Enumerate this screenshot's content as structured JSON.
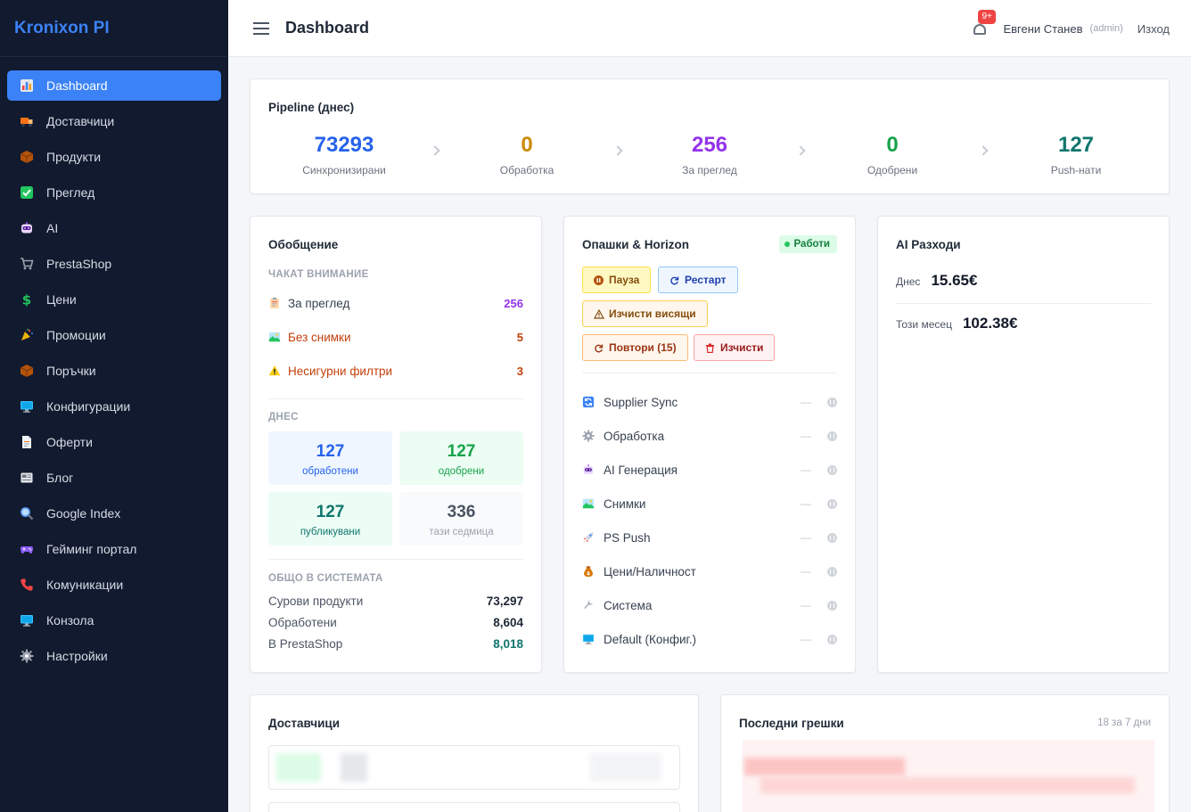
{
  "app": {
    "brand": "Kronixon PI",
    "page_title": "Dashboard"
  },
  "sidebar": {
    "items": [
      {
        "label": "Dashboard",
        "icon": "bar-chart-icon",
        "color": "#f59e0b",
        "active": true
      },
      {
        "label": "Доставчици",
        "icon": "truck-icon",
        "color": "#f97316"
      },
      {
        "label": "Продукти",
        "icon": "package-icon",
        "color": "#b45309"
      },
      {
        "label": "Преглед",
        "icon": "check-box-icon",
        "color": "#22c55e"
      },
      {
        "label": "AI",
        "icon": "robot-icon",
        "color": "#a855f7"
      },
      {
        "label": "PrestaShop",
        "icon": "cart-icon",
        "color": "#9ca3af"
      },
      {
        "label": "Цени",
        "icon": "dollar-icon",
        "color": "#22c55e"
      },
      {
        "label": "Промоции",
        "icon": "party-popper-icon",
        "color": "#eab308"
      },
      {
        "label": "Поръчки",
        "icon": "package-icon",
        "color": "#b45309"
      },
      {
        "label": "Конфигурации",
        "icon": "monitor-icon",
        "color": "#38bdf8"
      },
      {
        "label": "Оферти",
        "icon": "document-icon",
        "color": "#f1f5f9"
      },
      {
        "label": "Блог",
        "icon": "newspaper-icon",
        "color": "#e5e7eb"
      },
      {
        "label": "Google Index",
        "icon": "magnifier-icon",
        "color": "#60a5fa"
      },
      {
        "label": "Гейминг портал",
        "icon": "gamepad-icon",
        "color": "#8b5cf6"
      },
      {
        "label": "Комуникации",
        "icon": "phone-icon",
        "color": "#ef4444"
      },
      {
        "label": "Конзола",
        "icon": "monitor-icon",
        "color": "#38bdf8"
      },
      {
        "label": "Настройки",
        "icon": "gear-icon",
        "color": "#9ca3af"
      }
    ]
  },
  "topbar": {
    "notification_badge": "9+",
    "user_name": "Евгени Станев",
    "user_role": "(admin)",
    "logout": "Изход"
  },
  "pipeline": {
    "title": "Pipeline (днес)",
    "stages": [
      {
        "value": "73293",
        "label": "Синхронизирани",
        "color": "#2563eb"
      },
      {
        "value": "0",
        "label": "Обработка",
        "color": "#ca8a04"
      },
      {
        "value": "256",
        "label": "За преглед",
        "color": "#9333ea"
      },
      {
        "value": "0",
        "label": "Одобрени",
        "color": "#16a34a"
      },
      {
        "value": "127",
        "label": "Push-нати",
        "color": "#0f766e"
      }
    ]
  },
  "summary": {
    "title": "Обобщение",
    "attention_label": "ЧАКАТ ВНИМАНИЕ",
    "attention": [
      {
        "text": "За преглед",
        "count": "256",
        "icon": "clipboard-icon",
        "text_color": "#374151",
        "count_color": "#9333ea"
      },
      {
        "text": "Без снимки",
        "count": "5",
        "icon": "picture-icon",
        "text_color": "#c2410c",
        "count_color": "#c2410c"
      },
      {
        "text": "Несигурни филтри",
        "count": "3",
        "icon": "warning-icon",
        "text_color": "#c2410c",
        "count_color": "#c2410c"
      }
    ],
    "today_label": "ДНЕС",
    "tiles": [
      {
        "value": "127",
        "label": "обработени",
        "bg": "#eff6ff",
        "color": "#2563eb"
      },
      {
        "value": "127",
        "label": "одобрени",
        "bg": "#ecfdf3",
        "color": "#16a34a"
      },
      {
        "value": "127",
        "label": "публикувани",
        "bg": "#ecfdf5",
        "color": "#0f766e"
      },
      {
        "value": "336",
        "label": "тази седмица",
        "bg": "#f8fafc",
        "color": "#4b5563"
      }
    ],
    "totals_label": "ОБЩО В СИСТЕМАТА",
    "totals": [
      {
        "label": "Сурови продукти",
        "value": "73,297",
        "color": "#1f2937"
      },
      {
        "label": "Обработени",
        "value": "8,604",
        "color": "#1f2937"
      },
      {
        "label": "В PrestaShop",
        "value": "8,018",
        "color": "#0f766e"
      }
    ]
  },
  "queues": {
    "title": "Опашки & Horizon",
    "status": "Работи",
    "buttons": {
      "pause": "Пауза",
      "restart": "Рестарт",
      "clear_stuck": "Изчисти висящи",
      "retry": "Повтори (15)",
      "clear": "Изчисти"
    },
    "rows": [
      {
        "label": "Supplier Sync",
        "icon": "sync-icon",
        "color": "#3b82f6",
        "state": "—"
      },
      {
        "label": "Обработка",
        "icon": "gear-icon",
        "color": "#9ca3af",
        "state": "—"
      },
      {
        "label": "AI Генерация",
        "icon": "robot-icon",
        "color": "#a855f7",
        "state": "—"
      },
      {
        "label": "Снимки",
        "icon": "picture-icon",
        "color": "#16a34a",
        "state": "—"
      },
      {
        "label": "PS Push",
        "icon": "rocket-icon",
        "color": "#ef4444",
        "state": "—"
      },
      {
        "label": "Цени/Наличност",
        "icon": "money-bag-icon",
        "color": "#d97706",
        "state": "—"
      },
      {
        "label": "Система",
        "icon": "wrench-icon",
        "color": "#9ca3af",
        "state": "—"
      },
      {
        "label": "Default (Конфиг.)",
        "icon": "monitor-icon",
        "color": "#38bdf8",
        "state": "—"
      }
    ]
  },
  "ai_costs": {
    "title": "AI Разходи",
    "today_label": "Днес",
    "today_value": "15.65€",
    "month_label": "Този месец",
    "month_value": "102.38€"
  },
  "suppliers": {
    "title": "Доставчици"
  },
  "errors": {
    "title": "Последни грешки",
    "meta": "18 за 7 дни"
  }
}
